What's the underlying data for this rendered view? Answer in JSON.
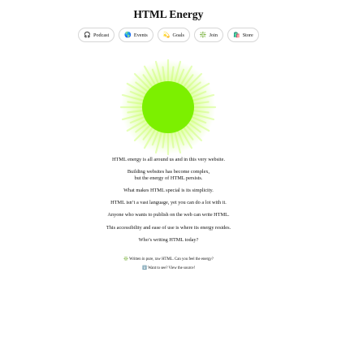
{
  "header": {
    "title": "HTML Energy"
  },
  "nav": [
    {
      "icon_name": "headphones-icon",
      "glyph": "🎧",
      "label": "Podcast"
    },
    {
      "icon_name": "globe-icon",
      "glyph": "🌎",
      "label": "Events"
    },
    {
      "icon_name": "dizzy-star-icon",
      "glyph": "💫",
      "label": "Goals"
    },
    {
      "icon_name": "sparkle-icon",
      "glyph": "❇️",
      "label": "Join"
    },
    {
      "icon_name": "shopping-bag-icon",
      "glyph": "🛍️",
      "label": "Store"
    }
  ],
  "sun": {
    "icon_name": "glowing-sun-icon",
    "core_color": "#7cf000",
    "glow_color": "#c8ff66"
  },
  "main": {
    "paragraphs": [
      {
        "lines": [
          "HTML energy is all around us and in this very website."
        ]
      },
      {
        "lines": [
          "Building websites has become complex,",
          "but the energy of HTML persists."
        ]
      },
      {
        "lines": [
          "What makes HTML special is its simplicity."
        ]
      },
      {
        "lines": [
          "HTML isn’t a vast language, yet you can do a lot with it."
        ]
      },
      {
        "lines": [
          "Anyone who wants to publish on the web can write HTML."
        ]
      },
      {
        "lines": [
          "This accessibility and ease of use is where its energy resides."
        ]
      },
      {
        "lines": [
          "Who’s writing HTML today?"
        ]
      }
    ]
  },
  "footer": {
    "written_glyph": "❇️",
    "written_text": "Written in pure, raw HTML. Can you feel the energy?",
    "source_glyph": "⬇️",
    "source_text": "Want to see? View the source!"
  }
}
